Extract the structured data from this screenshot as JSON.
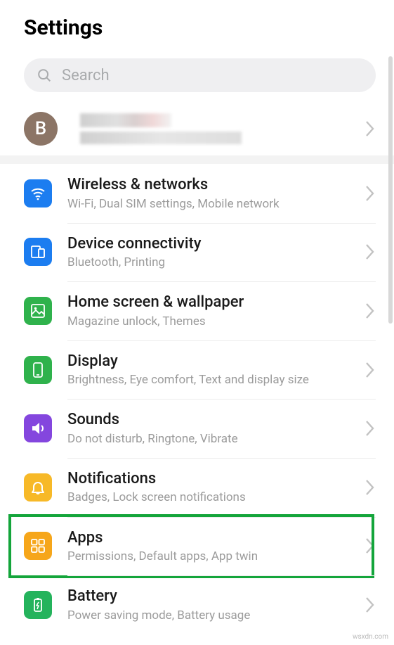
{
  "header": {
    "title": "Settings"
  },
  "search": {
    "placeholder": "Search"
  },
  "account": {
    "letter": "B"
  },
  "items": [
    {
      "id": "wireless",
      "title": "Wireless & networks",
      "sub": "Wi-Fi, Dual SIM settings, Mobile network",
      "icon": "wifi-icon",
      "color": "ic-blue"
    },
    {
      "id": "device-connectivity",
      "title": "Device connectivity",
      "sub": "Bluetooth, Printing",
      "icon": "device-icon",
      "color": "ic-blue"
    },
    {
      "id": "home-screen",
      "title": "Home screen & wallpaper",
      "sub": "Magazine unlock, Themes",
      "icon": "wallpaper-icon",
      "color": "ic-green"
    },
    {
      "id": "display",
      "title": "Display",
      "sub": "Brightness, Eye comfort, Text and display size",
      "icon": "display-icon",
      "color": "ic-green"
    },
    {
      "id": "sounds",
      "title": "Sounds",
      "sub": "Do not disturb, Ringtone, Vibrate",
      "icon": "sound-icon",
      "color": "ic-purple"
    },
    {
      "id": "notifications",
      "title": "Notifications",
      "sub": "Badges, Lock screen notifications",
      "icon": "bell-icon",
      "color": "ic-yellow"
    },
    {
      "id": "apps",
      "title": "Apps",
      "sub": "Permissions, Default apps, App twin",
      "icon": "apps-icon",
      "color": "ic-amber",
      "highlighted": true
    },
    {
      "id": "battery",
      "title": "Battery",
      "sub": "Power saving mode, Battery usage",
      "icon": "battery-icon",
      "color": "ic-green2"
    }
  ],
  "watermark": "wsxdn.com"
}
